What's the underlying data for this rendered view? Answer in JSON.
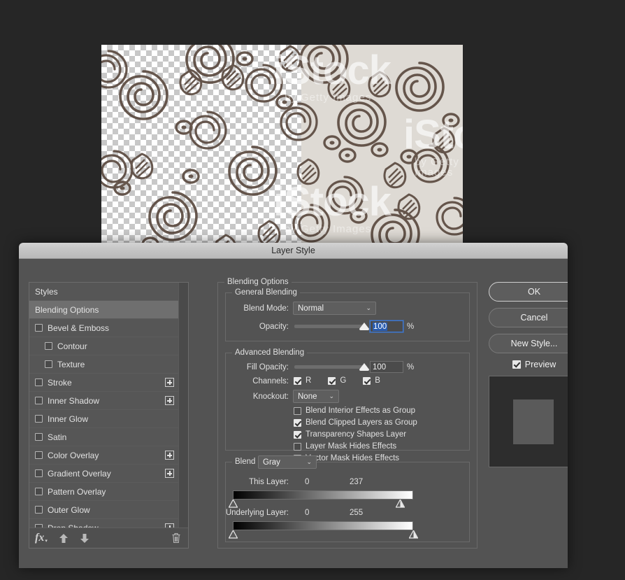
{
  "document": {
    "watermark_main": "iStock",
    "watermark_sub": "by Getty Images"
  },
  "dialog": {
    "title": "Layer Style"
  },
  "styles_panel": {
    "rows": [
      {
        "label": "Styles",
        "type": "header",
        "selected": false,
        "indent": false,
        "checkbox": false,
        "checked": false,
        "plus": false
      },
      {
        "label": "Blending Options",
        "type": "header",
        "selected": true,
        "indent": false,
        "checkbox": false,
        "checked": false,
        "plus": false
      },
      {
        "label": "Bevel & Emboss",
        "type": "effect",
        "selected": false,
        "indent": false,
        "checkbox": true,
        "checked": false,
        "plus": false
      },
      {
        "label": "Contour",
        "type": "sub",
        "selected": false,
        "indent": true,
        "checkbox": true,
        "checked": false,
        "plus": false
      },
      {
        "label": "Texture",
        "type": "sub",
        "selected": false,
        "indent": true,
        "checkbox": true,
        "checked": false,
        "plus": false
      },
      {
        "label": "Stroke",
        "type": "effect",
        "selected": false,
        "indent": false,
        "checkbox": true,
        "checked": false,
        "plus": true
      },
      {
        "label": "Inner Shadow",
        "type": "effect",
        "selected": false,
        "indent": false,
        "checkbox": true,
        "checked": false,
        "plus": true
      },
      {
        "label": "Inner Glow",
        "type": "effect",
        "selected": false,
        "indent": false,
        "checkbox": true,
        "checked": false,
        "plus": false
      },
      {
        "label": "Satin",
        "type": "effect",
        "selected": false,
        "indent": false,
        "checkbox": true,
        "checked": false,
        "plus": false
      },
      {
        "label": "Color Overlay",
        "type": "effect",
        "selected": false,
        "indent": false,
        "checkbox": true,
        "checked": false,
        "plus": true
      },
      {
        "label": "Gradient Overlay",
        "type": "effect",
        "selected": false,
        "indent": false,
        "checkbox": true,
        "checked": false,
        "plus": true
      },
      {
        "label": "Pattern Overlay",
        "type": "effect",
        "selected": false,
        "indent": false,
        "checkbox": true,
        "checked": false,
        "plus": false
      },
      {
        "label": "Outer Glow",
        "type": "effect",
        "selected": false,
        "indent": false,
        "checkbox": true,
        "checked": false,
        "plus": false
      },
      {
        "label": "Drop Shadow",
        "type": "effect",
        "selected": false,
        "indent": false,
        "checkbox": true,
        "checked": false,
        "plus": true
      }
    ],
    "footer": {
      "fx_label": "fx",
      "move_up": "↑",
      "move_down": "↓",
      "delete": "delete-effect"
    }
  },
  "options": {
    "section_title": "Blending Options",
    "general": {
      "title": "General Blending",
      "blend_mode_label": "Blend Mode:",
      "blend_mode_value": "Normal",
      "opacity_label": "Opacity:",
      "opacity_value": "100",
      "opacity_unit": "%",
      "opacity_percent": 100
    },
    "advanced": {
      "title": "Advanced Blending",
      "fill_opacity_label": "Fill Opacity:",
      "fill_opacity_value": "100",
      "fill_opacity_unit": "%",
      "fill_opacity_percent": 100,
      "channels_label": "Channels:",
      "channels": [
        {
          "label": "R",
          "checked": true
        },
        {
          "label": "G",
          "checked": true
        },
        {
          "label": "B",
          "checked": true
        }
      ],
      "knockout_label": "Knockout:",
      "knockout_value": "None",
      "checkboxes": [
        {
          "label": "Blend Interior Effects as Group",
          "checked": false
        },
        {
          "label": "Blend Clipped Layers as Group",
          "checked": true
        },
        {
          "label": "Transparency Shapes Layer",
          "checked": true
        },
        {
          "label": "Layer Mask Hides Effects",
          "checked": false
        },
        {
          "label": "Vector Mask Hides Effects",
          "checked": false
        }
      ]
    },
    "blend_if": {
      "title": "Blend If:",
      "channel_value": "Gray",
      "this_layer": {
        "label": "This Layer:",
        "black_value": "0",
        "white_value": "237",
        "black_pos_percent": 0,
        "white_pos_percent": 93
      },
      "underlying_layer": {
        "label": "Underlying Layer:",
        "black_value": "0",
        "white_value": "255",
        "black_pos_percent": 0,
        "white_pos_percent": 100
      }
    }
  },
  "buttons": {
    "ok": "OK",
    "cancel": "Cancel",
    "new_style": "New Style...",
    "preview_label": "Preview",
    "preview_checked": true
  },
  "colors": {
    "dialog_bg": "#535353",
    "titlebar": "#c5c5c5",
    "selected_row": "#6f6f6f",
    "focus_blue": "#3c79d8",
    "selection_blue": "#2a5db0",
    "text": "#e2e2e2"
  }
}
